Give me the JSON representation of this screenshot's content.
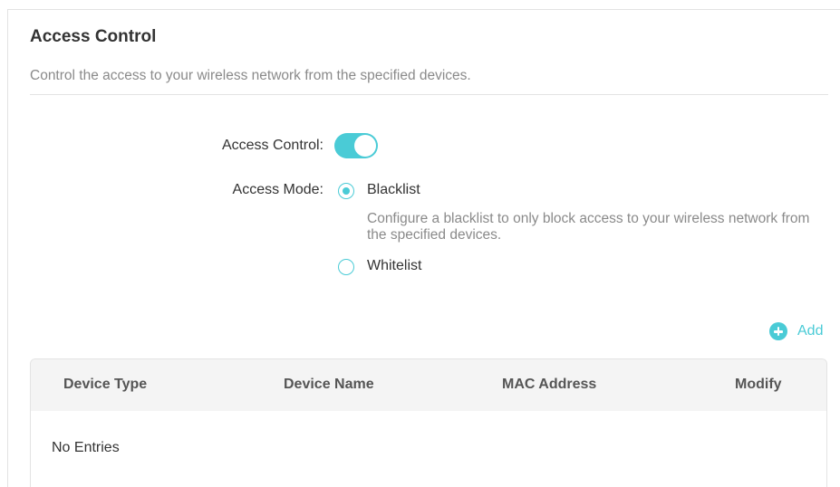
{
  "section": {
    "title": "Access Control",
    "description": "Control the access to your wireless network from the specified devices."
  },
  "form": {
    "access_control_label": "Access Control:",
    "access_control_enabled": true,
    "access_mode_label": "Access Mode:",
    "modes": [
      {
        "label": "Blacklist",
        "selected": true,
        "hint": "Configure a blacklist to only block access to your wireless network from the specified devices."
      },
      {
        "label": "Whitelist",
        "selected": false
      }
    ]
  },
  "add_button": {
    "label": "Add"
  },
  "table": {
    "columns": [
      "Device Type",
      "Device Name",
      "MAC Address",
      "Modify"
    ],
    "empty_text": "No Entries"
  },
  "colors": {
    "accent": "#4acbd6",
    "muted_text": "#8a8a8a",
    "header_bg": "#f4f4f4"
  }
}
